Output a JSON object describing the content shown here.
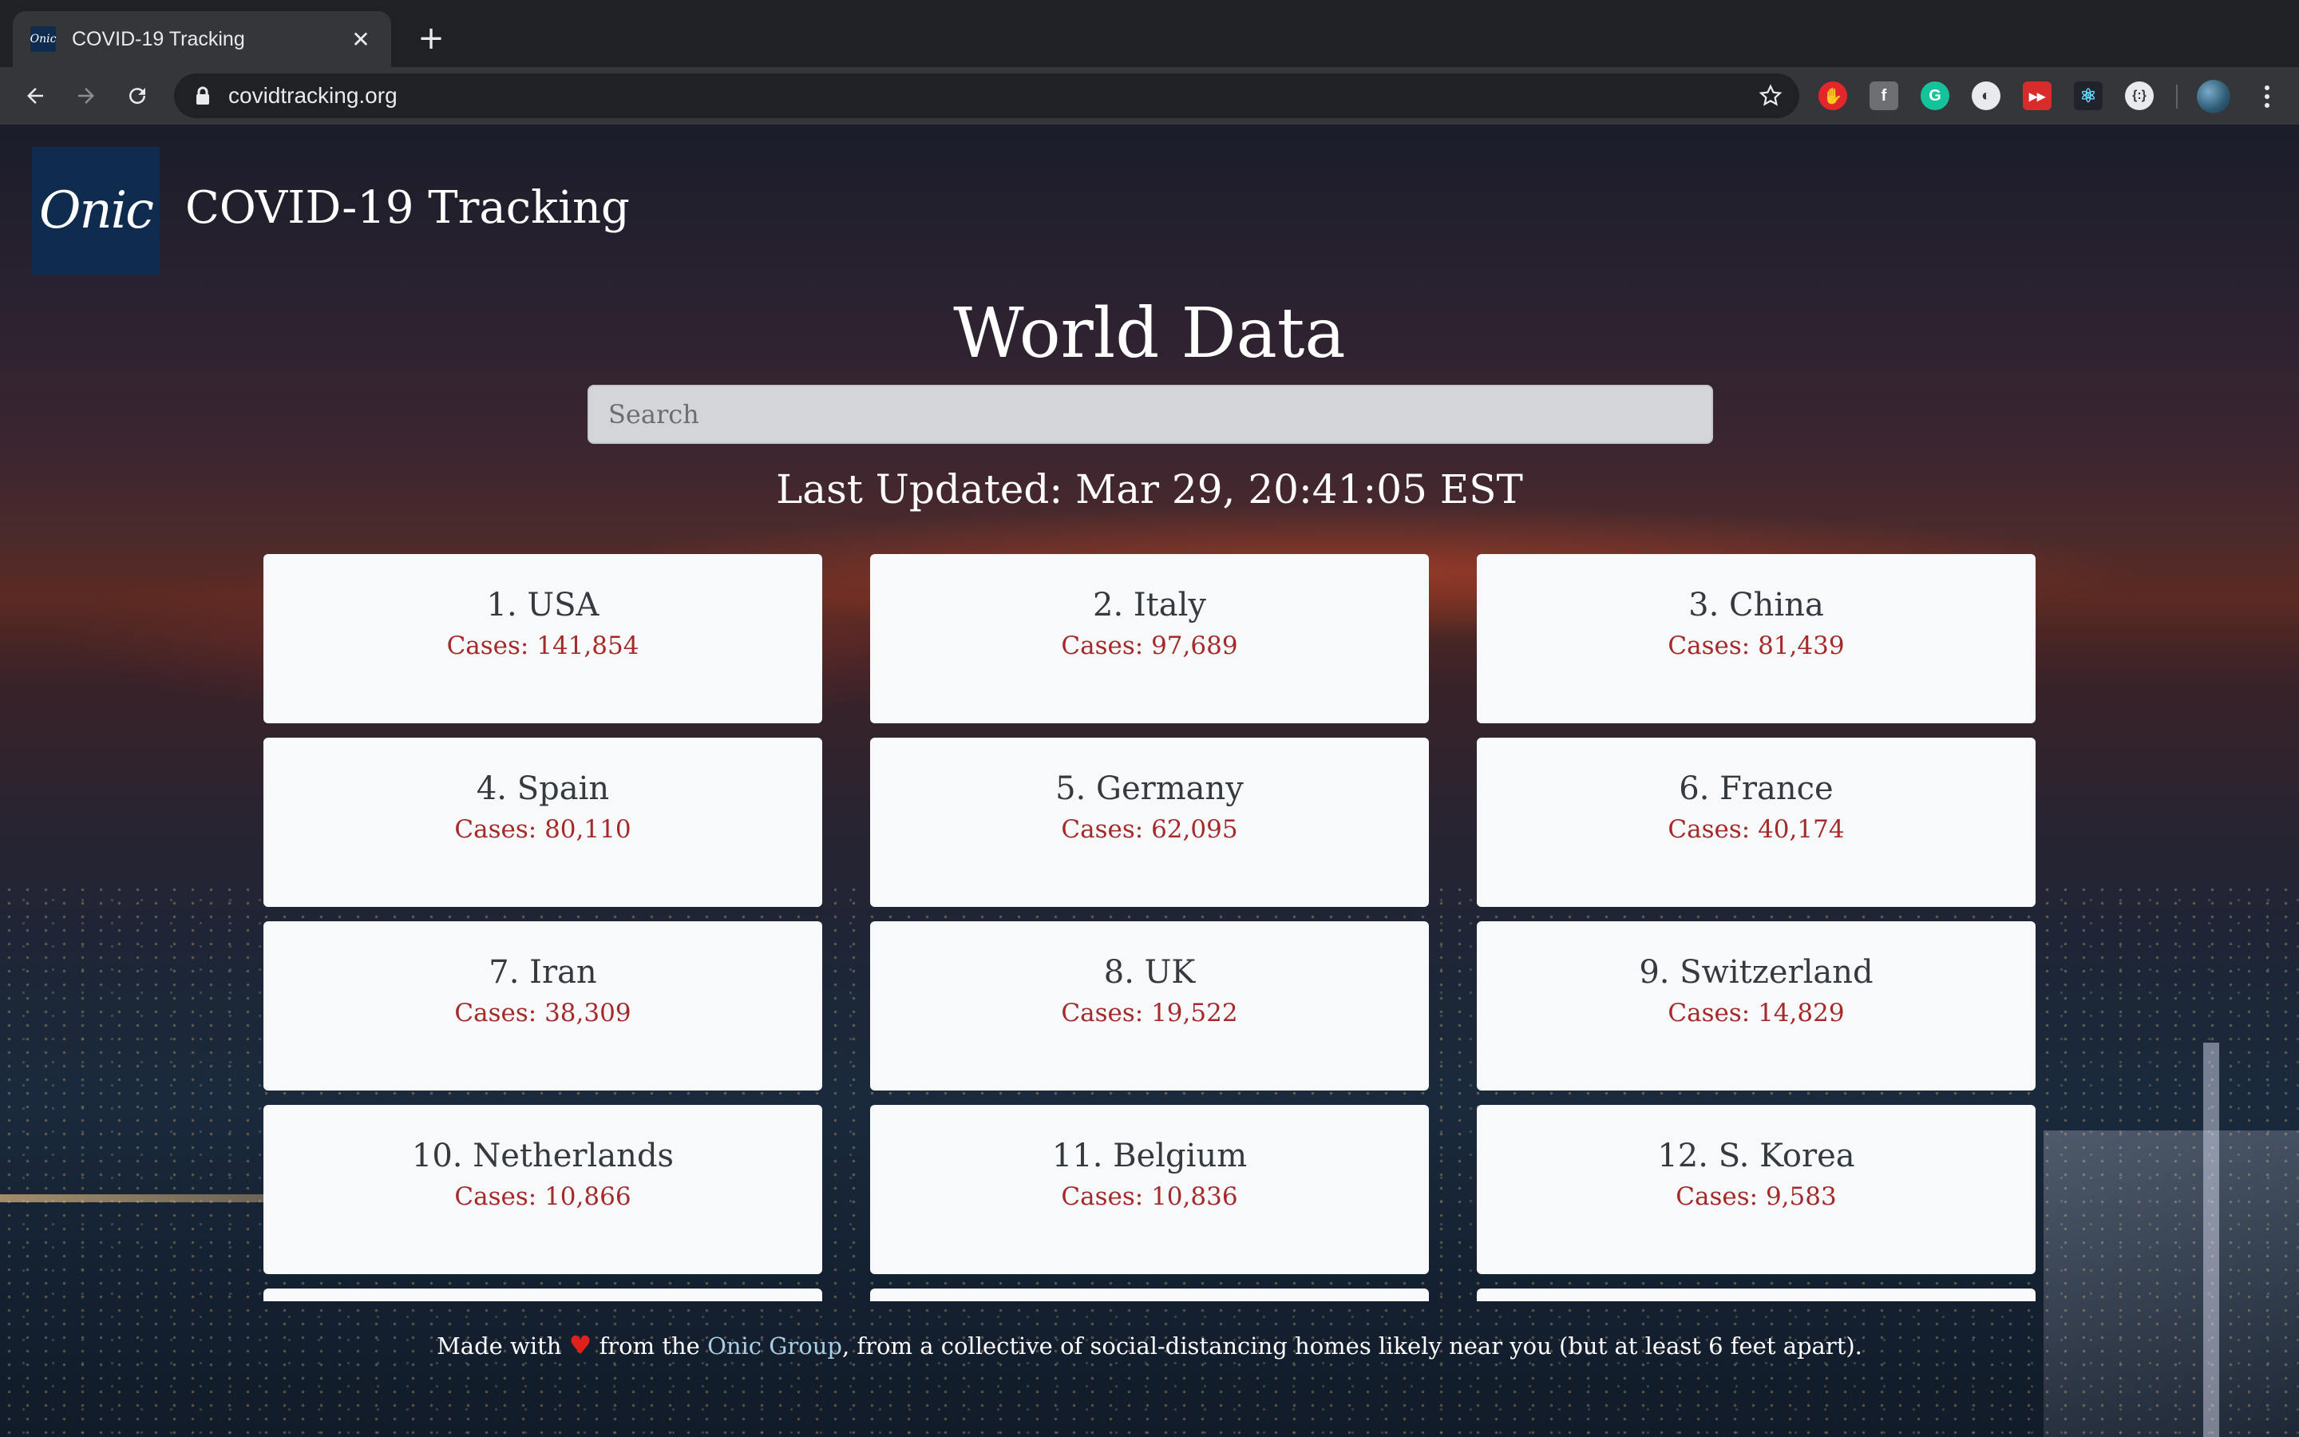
{
  "browser": {
    "tab_title": "COVID-19 Tracking",
    "tab_favicon_text": "Onic",
    "url": "covidtracking.org"
  },
  "header": {
    "logo_text": "Onic",
    "title": "COVID-19 Tracking"
  },
  "main": {
    "heading": "World Data",
    "search_placeholder": "Search",
    "last_updated": "Last Updated: Mar 29, 20:41:05 EST",
    "countries": [
      {
        "name": "1. USA",
        "cases": "Cases: 141,854"
      },
      {
        "name": "2. Italy",
        "cases": "Cases: 97,689"
      },
      {
        "name": "3. China",
        "cases": "Cases: 81,439"
      },
      {
        "name": "4. Spain",
        "cases": "Cases: 80,110"
      },
      {
        "name": "5. Germany",
        "cases": "Cases: 62,095"
      },
      {
        "name": "6. France",
        "cases": "Cases: 40,174"
      },
      {
        "name": "7. Iran",
        "cases": "Cases: 38,309"
      },
      {
        "name": "8. UK",
        "cases": "Cases: 19,522"
      },
      {
        "name": "9. Switzerland",
        "cases": "Cases: 14,829"
      },
      {
        "name": "10. Netherlands",
        "cases": "Cases: 10,866"
      },
      {
        "name": "11. Belgium",
        "cases": "Cases: 10,836"
      },
      {
        "name": "12. S. Korea",
        "cases": "Cases: 9,583"
      }
    ]
  },
  "footer": {
    "made_with": "Made with",
    "from_the": "from the",
    "group_link": "Onic Group",
    "rest": ", from a collective of social-distancing homes likely near you (but at least 6 feet apart)."
  },
  "colors": {
    "card_bg": "#f8f9fa",
    "cases_red": "#a52a2a",
    "logo_navy": "#0f2b4e",
    "link_blue": "#a8cde4",
    "heart_red": "#e0201b"
  }
}
